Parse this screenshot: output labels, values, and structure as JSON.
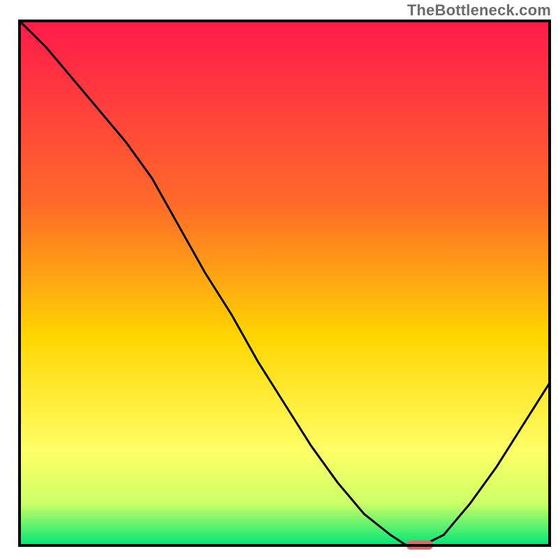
{
  "watermark": "TheBottleneck.com",
  "colors": {
    "gradient_top": "#ff1a4a",
    "gradient_mid1": "#ff6a2a",
    "gradient_mid2": "#ffd500",
    "gradient_mid3": "#ffff66",
    "gradient_mid4": "#ccff66",
    "gradient_bottom": "#00e676",
    "frame": "#000000",
    "curve": "#000000",
    "marker_fill": "#dd6a6a"
  },
  "chart_data": {
    "type": "line",
    "title": "",
    "xlabel": "",
    "ylabel": "",
    "xlim": [
      0,
      100
    ],
    "ylim": [
      0,
      100
    ],
    "x": [
      0,
      5,
      10,
      15,
      20,
      25,
      30,
      35,
      40,
      45,
      50,
      55,
      60,
      65,
      70,
      73,
      76,
      80,
      85,
      90,
      95,
      100
    ],
    "values": [
      100,
      95,
      89,
      83,
      77,
      70,
      61,
      52,
      44,
      35,
      27,
      19,
      12,
      6,
      2,
      0,
      0,
      2,
      8,
      15,
      23,
      31
    ],
    "marker": {
      "x_start": 73,
      "x_end": 78,
      "y": 0
    },
    "annotations": []
  }
}
